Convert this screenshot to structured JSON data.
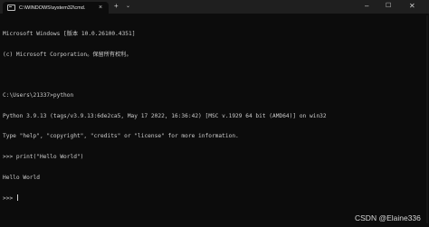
{
  "window": {
    "tab_title": "C:\\WINDOWS\\system32\\cmd.",
    "tab_close_glyph": "×",
    "new_tab_glyph": "+",
    "dropdown_glyph": "⌄",
    "minimize_glyph": "–",
    "maximize_glyph": "☐",
    "close_glyph": "✕"
  },
  "terminal": {
    "lines": [
      "Microsoft Windows [版本 10.0.26100.4351]",
      "(c) Microsoft Corporation。保留所有权利。",
      "",
      "C:\\Users\\21337>python",
      "Python 3.9.13 (tags/v3.9.13:6de2ca5, May 17 2022, 16:36:42) [MSC v.1929 64 bit (AMD64)] on win32",
      "Type \"help\", \"copyright\", \"credits\" or \"license\" for more information.",
      ">>> print(\"Hello World\")",
      "Hello World",
      ">>> "
    ]
  },
  "watermark": "CSDN @Elaine336",
  "colors": {
    "background": "#0c0c0c",
    "titlebar": "#1f1f1f",
    "text": "#cccccc"
  }
}
